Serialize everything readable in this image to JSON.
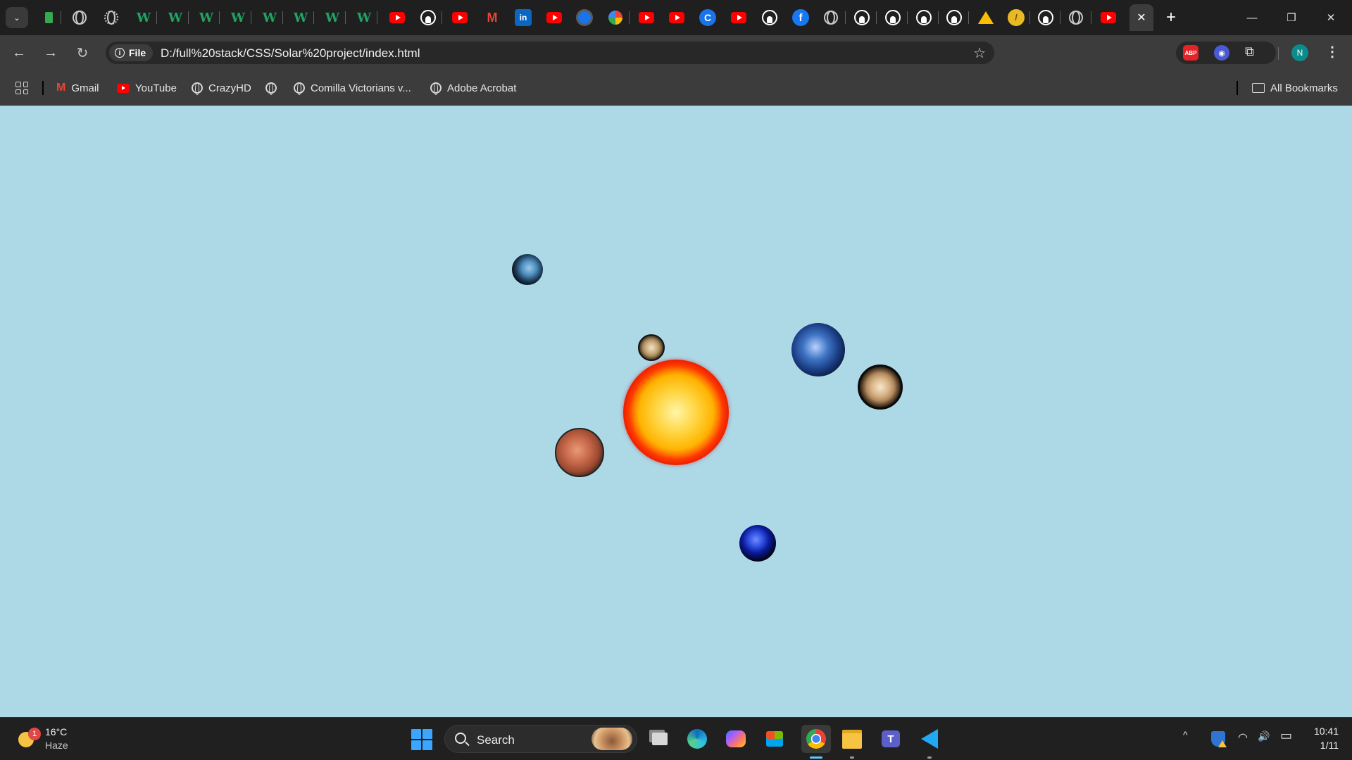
{
  "browser": {
    "tab_search_glyph": "⌄",
    "active_tab_close": "✕",
    "new_tab": "+",
    "window_controls": {
      "minimize": "—",
      "restore": "❐",
      "close": "✕"
    },
    "tab_icons": [
      "doc-icon",
      "globe-icon",
      "openai-icon",
      "w-icon",
      "w-icon",
      "w-icon",
      "w-icon",
      "w-icon",
      "w-icon",
      "w-icon",
      "w-icon",
      "youtube-icon",
      "github-icon",
      "youtube-icon",
      "gmail-icon",
      "linkedin-icon",
      "youtube-icon",
      "blue-app-icon",
      "multicolor-icon",
      "youtube-icon",
      "youtube-icon",
      "c-icon",
      "youtube-icon",
      "github-icon",
      "facebook-icon",
      "globe-icon",
      "github-icon",
      "github-icon",
      "github-icon",
      "github-icon",
      "drive-icon",
      "yellow-coin-icon",
      "github-icon",
      "globe-icon",
      "youtube-icon"
    ],
    "toolbar": {
      "back": "←",
      "forward": "→",
      "reload": "↻",
      "file_chip_label": "File",
      "info_glyph": "i",
      "url": "D:/full%20stack/CSS/Solar%20project/index.html",
      "star": "☆",
      "abp_label": "ABP",
      "rss_glyph": "◉",
      "puzzle_glyph": "⧉",
      "profile_initial": "N",
      "menu": "⋮"
    },
    "bookmarks": {
      "items": [
        {
          "label": "Gmail",
          "icon": "gmail-icon"
        },
        {
          "label": "YouTube",
          "icon": "youtube-icon"
        },
        {
          "label": "CrazyHD",
          "icon": "globe-icon"
        },
        {
          "label": "",
          "icon": "globe-icon"
        },
        {
          "label": "Comilla Victorians v...",
          "icon": "globe-icon"
        },
        {
          "label": "Adobe Acrobat",
          "icon": "globe-icon"
        }
      ],
      "all_bookmarks": "All Bookmarks"
    }
  },
  "page": {
    "background_color": "#add8e6",
    "bodies": [
      "sun",
      "planet-top",
      "planet-small",
      "earth",
      "jupiter",
      "mars",
      "neptune"
    ]
  },
  "taskbar": {
    "weather": {
      "temp": "16°C",
      "condition": "Haze",
      "badge": "1"
    },
    "search_label": "Search",
    "apps": [
      "task-view",
      "edge",
      "copilot",
      "store",
      "chrome",
      "file-explorer",
      "teams",
      "vscode"
    ],
    "tray": {
      "chevron": "^",
      "wifi": "◠",
      "volume": "🔊",
      "battery": "▭"
    },
    "clock": {
      "time": "10:41",
      "date": "1/11"
    }
  }
}
